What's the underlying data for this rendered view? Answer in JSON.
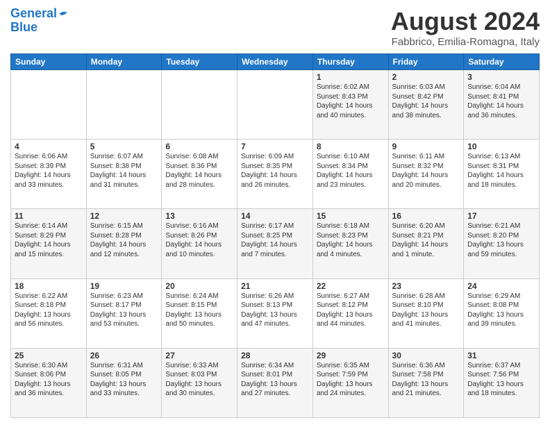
{
  "header": {
    "logo_line1": "General",
    "logo_line2": "Blue",
    "month": "August 2024",
    "location": "Fabbrico, Emilia-Romagna, Italy"
  },
  "weekdays": [
    "Sunday",
    "Monday",
    "Tuesday",
    "Wednesday",
    "Thursday",
    "Friday",
    "Saturday"
  ],
  "rows": [
    [
      {
        "day": "",
        "info": ""
      },
      {
        "day": "",
        "info": ""
      },
      {
        "day": "",
        "info": ""
      },
      {
        "day": "",
        "info": ""
      },
      {
        "day": "1",
        "info": "Sunrise: 6:02 AM\nSunset: 8:43 PM\nDaylight: 14 hours\nand 40 minutes."
      },
      {
        "day": "2",
        "info": "Sunrise: 6:03 AM\nSunset: 8:42 PM\nDaylight: 14 hours\nand 38 minutes."
      },
      {
        "day": "3",
        "info": "Sunrise: 6:04 AM\nSunset: 8:41 PM\nDaylight: 14 hours\nand 36 minutes."
      }
    ],
    [
      {
        "day": "4",
        "info": "Sunrise: 6:06 AM\nSunset: 8:39 PM\nDaylight: 14 hours\nand 33 minutes."
      },
      {
        "day": "5",
        "info": "Sunrise: 6:07 AM\nSunset: 8:38 PM\nDaylight: 14 hours\nand 31 minutes."
      },
      {
        "day": "6",
        "info": "Sunrise: 6:08 AM\nSunset: 8:36 PM\nDaylight: 14 hours\nand 28 minutes."
      },
      {
        "day": "7",
        "info": "Sunrise: 6:09 AM\nSunset: 8:35 PM\nDaylight: 14 hours\nand 26 minutes."
      },
      {
        "day": "8",
        "info": "Sunrise: 6:10 AM\nSunset: 8:34 PM\nDaylight: 14 hours\nand 23 minutes."
      },
      {
        "day": "9",
        "info": "Sunrise: 6:11 AM\nSunset: 8:32 PM\nDaylight: 14 hours\nand 20 minutes."
      },
      {
        "day": "10",
        "info": "Sunrise: 6:13 AM\nSunset: 8:31 PM\nDaylight: 14 hours\nand 18 minutes."
      }
    ],
    [
      {
        "day": "11",
        "info": "Sunrise: 6:14 AM\nSunset: 8:29 PM\nDaylight: 14 hours\nand 15 minutes."
      },
      {
        "day": "12",
        "info": "Sunrise: 6:15 AM\nSunset: 8:28 PM\nDaylight: 14 hours\nand 12 minutes."
      },
      {
        "day": "13",
        "info": "Sunrise: 6:16 AM\nSunset: 8:26 PM\nDaylight: 14 hours\nand 10 minutes."
      },
      {
        "day": "14",
        "info": "Sunrise: 6:17 AM\nSunset: 8:25 PM\nDaylight: 14 hours\nand 7 minutes."
      },
      {
        "day": "15",
        "info": "Sunrise: 6:18 AM\nSunset: 8:23 PM\nDaylight: 14 hours\nand 4 minutes."
      },
      {
        "day": "16",
        "info": "Sunrise: 6:20 AM\nSunset: 8:21 PM\nDaylight: 14 hours\nand 1 minute."
      },
      {
        "day": "17",
        "info": "Sunrise: 6:21 AM\nSunset: 8:20 PM\nDaylight: 13 hours\nand 59 minutes."
      }
    ],
    [
      {
        "day": "18",
        "info": "Sunrise: 6:22 AM\nSunset: 8:18 PM\nDaylight: 13 hours\nand 56 minutes."
      },
      {
        "day": "19",
        "info": "Sunrise: 6:23 AM\nSunset: 8:17 PM\nDaylight: 13 hours\nand 53 minutes."
      },
      {
        "day": "20",
        "info": "Sunrise: 6:24 AM\nSunset: 8:15 PM\nDaylight: 13 hours\nand 50 minutes."
      },
      {
        "day": "21",
        "info": "Sunrise: 6:26 AM\nSunset: 8:13 PM\nDaylight: 13 hours\nand 47 minutes."
      },
      {
        "day": "22",
        "info": "Sunrise: 6:27 AM\nSunset: 8:12 PM\nDaylight: 13 hours\nand 44 minutes."
      },
      {
        "day": "23",
        "info": "Sunrise: 6:28 AM\nSunset: 8:10 PM\nDaylight: 13 hours\nand 41 minutes."
      },
      {
        "day": "24",
        "info": "Sunrise: 6:29 AM\nSunset: 8:08 PM\nDaylight: 13 hours\nand 39 minutes."
      }
    ],
    [
      {
        "day": "25",
        "info": "Sunrise: 6:30 AM\nSunset: 8:06 PM\nDaylight: 13 hours\nand 36 minutes."
      },
      {
        "day": "26",
        "info": "Sunrise: 6:31 AM\nSunset: 8:05 PM\nDaylight: 13 hours\nand 33 minutes."
      },
      {
        "day": "27",
        "info": "Sunrise: 6:33 AM\nSunset: 8:03 PM\nDaylight: 13 hours\nand 30 minutes."
      },
      {
        "day": "28",
        "info": "Sunrise: 6:34 AM\nSunset: 8:01 PM\nDaylight: 13 hours\nand 27 minutes."
      },
      {
        "day": "29",
        "info": "Sunrise: 6:35 AM\nSunset: 7:59 PM\nDaylight: 13 hours\nand 24 minutes."
      },
      {
        "day": "30",
        "info": "Sunrise: 6:36 AM\nSunset: 7:58 PM\nDaylight: 13 hours\nand 21 minutes."
      },
      {
        "day": "31",
        "info": "Sunrise: 6:37 AM\nSunset: 7:56 PM\nDaylight: 13 hours\nand 18 minutes."
      }
    ]
  ]
}
